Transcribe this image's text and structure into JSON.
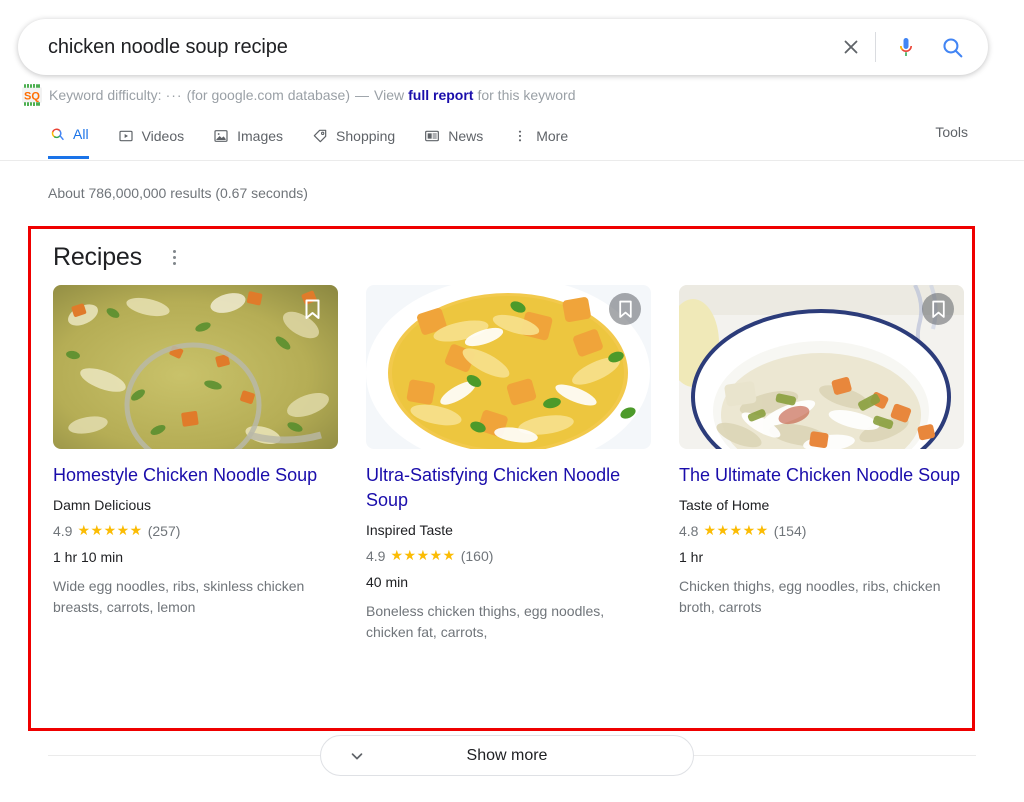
{
  "search": {
    "value": "chicken noodle soup recipe",
    "placeholder": "Search",
    "clear_icon": "close-icon",
    "mic_icon": "microphone-icon",
    "search_icon": "search-icon"
  },
  "seo_bar": {
    "logo": "seoquake-logo",
    "label": "Keyword difficulty:",
    "value_dots": "···",
    "database": "(for google.com database)",
    "dash": "—",
    "view": "View",
    "link": "full report",
    "suffix": "for this keyword"
  },
  "nav": {
    "tabs": [
      {
        "label": "All",
        "icon": "google-search-icon",
        "active": true
      },
      {
        "label": "Videos",
        "icon": "video-icon",
        "active": false
      },
      {
        "label": "Images",
        "icon": "image-icon",
        "active": false
      },
      {
        "label": "Shopping",
        "icon": "tag-icon",
        "active": false
      },
      {
        "label": "News",
        "icon": "news-icon",
        "active": false
      },
      {
        "label": "More",
        "icon": "kebab-icon",
        "active": false
      }
    ],
    "tools_label": "Tools"
  },
  "results": {
    "count_text": "About 786,000,000 results (0.67 seconds)"
  },
  "recipes": {
    "title": "Recipes",
    "menu_icon": "kebab-icon",
    "highlight_color": "#ef0000",
    "cards": [
      {
        "title": "Homestyle Chicken Noodle Soup",
        "source": "Damn Delicious",
        "rating": "4.9",
        "stars": "★★★★★",
        "reviews": "(257)",
        "time": "1 hr 10 min",
        "ingredients": "Wide egg noodles, ribs, skinless chicken breasts, carrots, lemon",
        "bookmark_icon": "bookmark-icon",
        "bookmark_shaded": false
      },
      {
        "title": "Ultra-Satisfying Chicken Noodle Soup",
        "source": "Inspired Taste",
        "rating": "4.9",
        "stars": "★★★★★",
        "reviews": "(160)",
        "time": "40 min",
        "ingredients": "Boneless chicken thighs, egg noodles, chicken fat, carrots,",
        "bookmark_icon": "bookmark-icon",
        "bookmark_shaded": true
      },
      {
        "title": "The Ultimate Chicken Noodle Soup",
        "source": "Taste of Home",
        "rating": "4.8",
        "stars": "★★★★★",
        "reviews": "(154)",
        "time": "1 hr",
        "ingredients": "Chicken thighs, egg noodles, ribs, chicken broth, carrots",
        "bookmark_icon": "bookmark-icon",
        "bookmark_shaded": true
      }
    ]
  },
  "show_more": {
    "label": "Show more",
    "icon": "chevron-down-icon"
  },
  "colors": {
    "link": "#1a0dab",
    "accent": "#1a73e8",
    "star": "#fbbc04",
    "muted": "#70757a",
    "highlight": "#ef0000"
  }
}
